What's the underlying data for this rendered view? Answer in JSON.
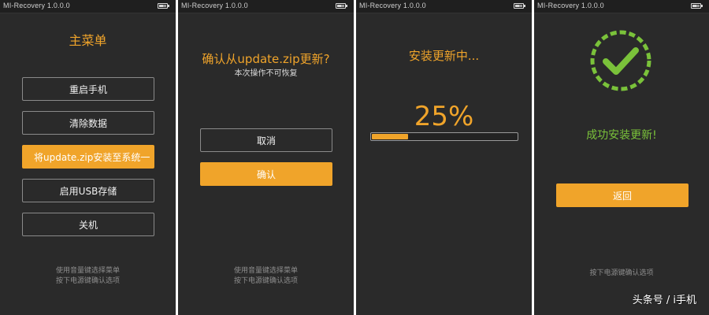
{
  "panels": [
    {
      "status_title": "MI-Recovery 1.0.0.0",
      "title": "主菜单",
      "buttons": [
        "重启手机",
        "清除数据",
        "将update.zip安装至系统一",
        "启用USB存储",
        "关机"
      ],
      "selected_index": 2,
      "hints": [
        "使用音量键选择菜单",
        "按下电源键确认选项"
      ]
    },
    {
      "status_title": "MI-Recovery 1.0.0.0",
      "title": "确认从update.zip更新?",
      "subtitle": "本次操作不可恢复",
      "buttons": [
        "取消",
        "确认"
      ],
      "hints": [
        "使用音量键选择菜单",
        "按下电源键确认选项"
      ]
    },
    {
      "status_title": "MI-Recovery 1.0.0.0",
      "title": "安装更新中...",
      "percent_text": "25%",
      "progress": 0.25
    },
    {
      "status_title": "MI-Recovery 1.0.0.0",
      "message": "成功安装更新!",
      "button": "返回",
      "hints": [
        "按下电源键确认选项"
      ]
    }
  ],
  "watermark": "头条号 / i手机",
  "colors": {
    "accent": "#f0a42a",
    "success": "#7ac23a",
    "panel_bg": "#2a2a2a",
    "text": "#f2f2f2",
    "hint": "#8e8e8e"
  },
  "icons": {
    "status_battery": "battery-icon",
    "success": "checkmark-circle-icon"
  }
}
